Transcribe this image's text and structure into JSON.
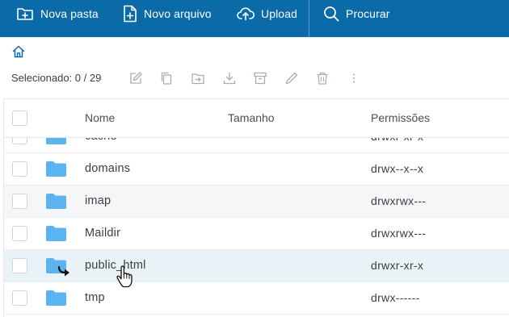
{
  "toolbar": {
    "new_folder": "Nova pasta",
    "new_file": "Novo arquivo",
    "upload": "Upload",
    "search": "Procurar"
  },
  "selection": {
    "label": "Selecionado: 0 / 29"
  },
  "actions": [
    "edit-icon",
    "copy-icon",
    "move-icon",
    "download-icon",
    "archive-icon",
    "rename-icon",
    "trash-icon",
    "more-icon"
  ],
  "table": {
    "columns": [
      "Nome",
      "Tamanho",
      "Permissões"
    ],
    "rows": [
      {
        "name": "cache",
        "permissions": "drwxr-xr-x"
      },
      {
        "name": "domains",
        "permissions": "drwx--x--x"
      },
      {
        "name": "imap",
        "permissions": "drwxrwx---"
      },
      {
        "name": "Maildir",
        "permissions": "drwxrwx---"
      },
      {
        "name": "public_html",
        "permissions": "drwxr-xr-x"
      },
      {
        "name": "tmp",
        "permissions": "drwx------"
      }
    ]
  },
  "colors": {
    "toolbar_bg": "#0b6aa8",
    "folder": "#5bb3f0",
    "row_hover": "#e9f2f7"
  }
}
